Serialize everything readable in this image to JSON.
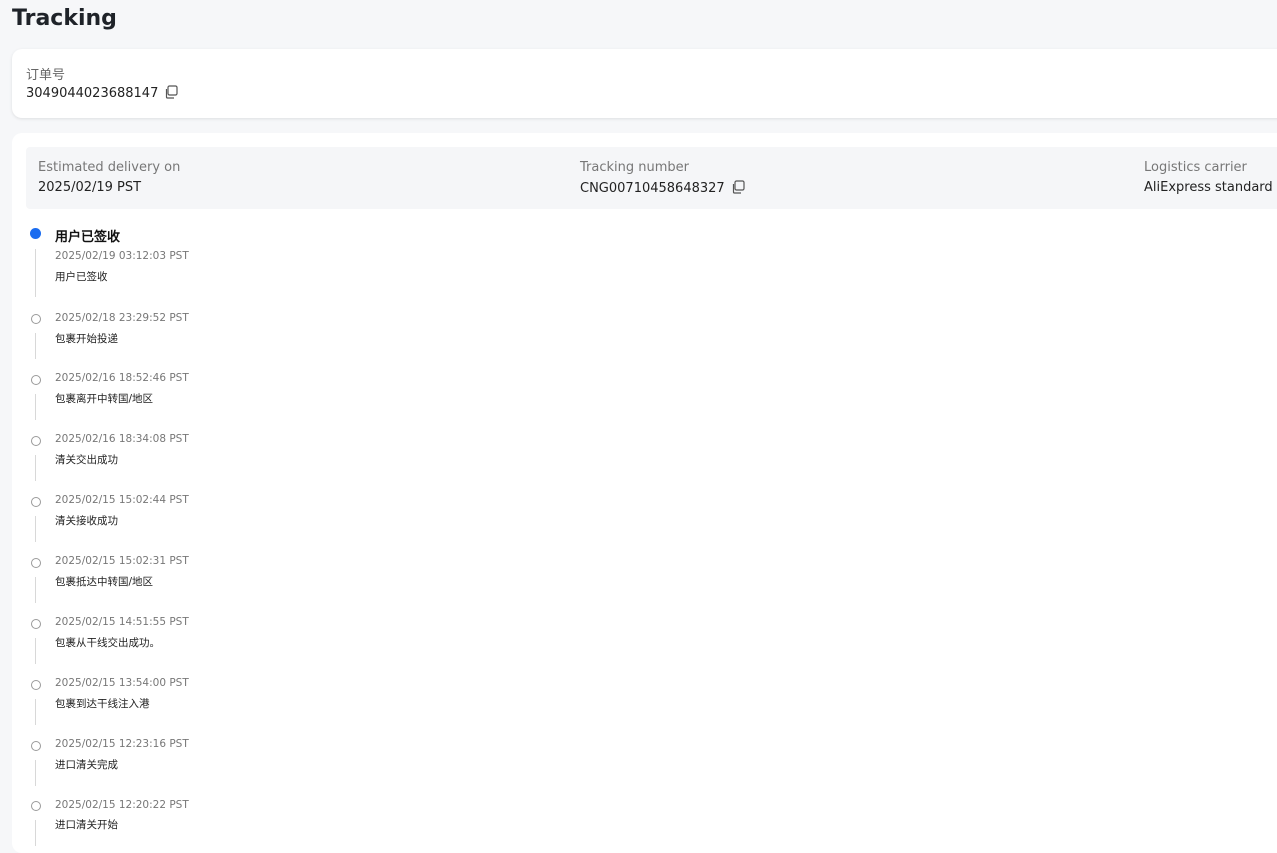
{
  "page": {
    "title": "Tracking"
  },
  "order": {
    "label": "订单号",
    "number": "3049044023688147"
  },
  "summary": {
    "estimated_label": "Estimated delivery on",
    "estimated_value": "2025/02/19 PST",
    "tracking_label": "Tracking number",
    "tracking_value": "CNG00710458648327",
    "carrier_label": "Logistics carrier",
    "carrier_value": "AliExpress standard sh"
  },
  "timeline": {
    "latest_title": "用户已签收",
    "events": [
      {
        "time": "2025/02/19 03:12:03 PST",
        "desc": "用户已签收"
      },
      {
        "time": "2025/02/18 23:29:52 PST",
        "desc": "包裹开始投递"
      },
      {
        "time": "2025/02/16 18:52:46 PST",
        "desc": "包裹离开中转国/地区"
      },
      {
        "time": "2025/02/16 18:34:08 PST",
        "desc": "清关交出成功"
      },
      {
        "time": "2025/02/15 15:02:44 PST",
        "desc": "清关接收成功"
      },
      {
        "time": "2025/02/15 15:02:31 PST",
        "desc": "包裹抵达中转国/地区"
      },
      {
        "time": "2025/02/15 14:51:55 PST",
        "desc": "包裹从干线交出成功。"
      },
      {
        "time": "2025/02/15 13:54:00 PST",
        "desc": "包裹到达干线注入港"
      },
      {
        "time": "2025/02/15 12:23:16 PST",
        "desc": "进口清关完成"
      },
      {
        "time": "2025/02/15 12:20:22 PST",
        "desc": "进口清关开始"
      }
    ]
  },
  "colors": {
    "accent": "#1a6cf0",
    "background": "#f6f7f9",
    "card": "#ffffff",
    "strip": "#f5f6f8"
  },
  "icons": {
    "copy": "copy-icon"
  }
}
